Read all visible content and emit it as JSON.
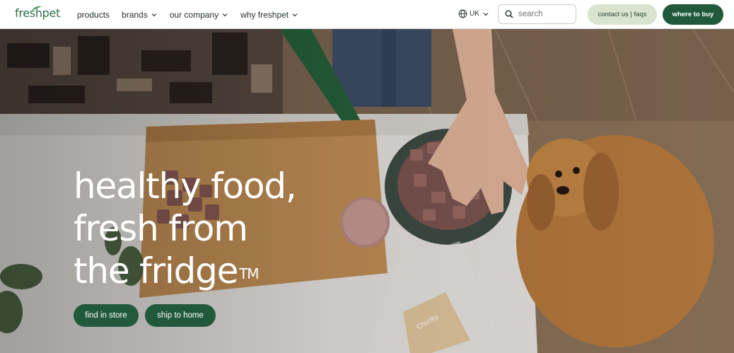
{
  "brand": {
    "logo_text": "freshpet",
    "color": "#2f6e47"
  },
  "nav": {
    "items": [
      {
        "label": "products",
        "has_dropdown": false
      },
      {
        "label": "brands",
        "has_dropdown": true
      },
      {
        "label": "our company",
        "has_dropdown": true
      },
      {
        "label": "why freshpet",
        "has_dropdown": true
      }
    ]
  },
  "region": {
    "label": "UK",
    "icon": "globe-icon"
  },
  "search": {
    "placeholder": "search",
    "value": "",
    "icon": "search-icon"
  },
  "header_buttons": {
    "contact_label": "contact us | faqs",
    "buy_label": "where to buy"
  },
  "hero": {
    "headline": [
      "healthy food,",
      "fresh from",
      "the fridge"
    ],
    "trademark": "TM",
    "buttons": {
      "store_label": "find in store",
      "home_label": "ship to home"
    },
    "package_text": "Chunky Chicken & Turkey Recipe"
  },
  "colors": {
    "accent_green": "#215a3a",
    "light_green": "#d9e4cf",
    "text_dark": "#27332c"
  }
}
